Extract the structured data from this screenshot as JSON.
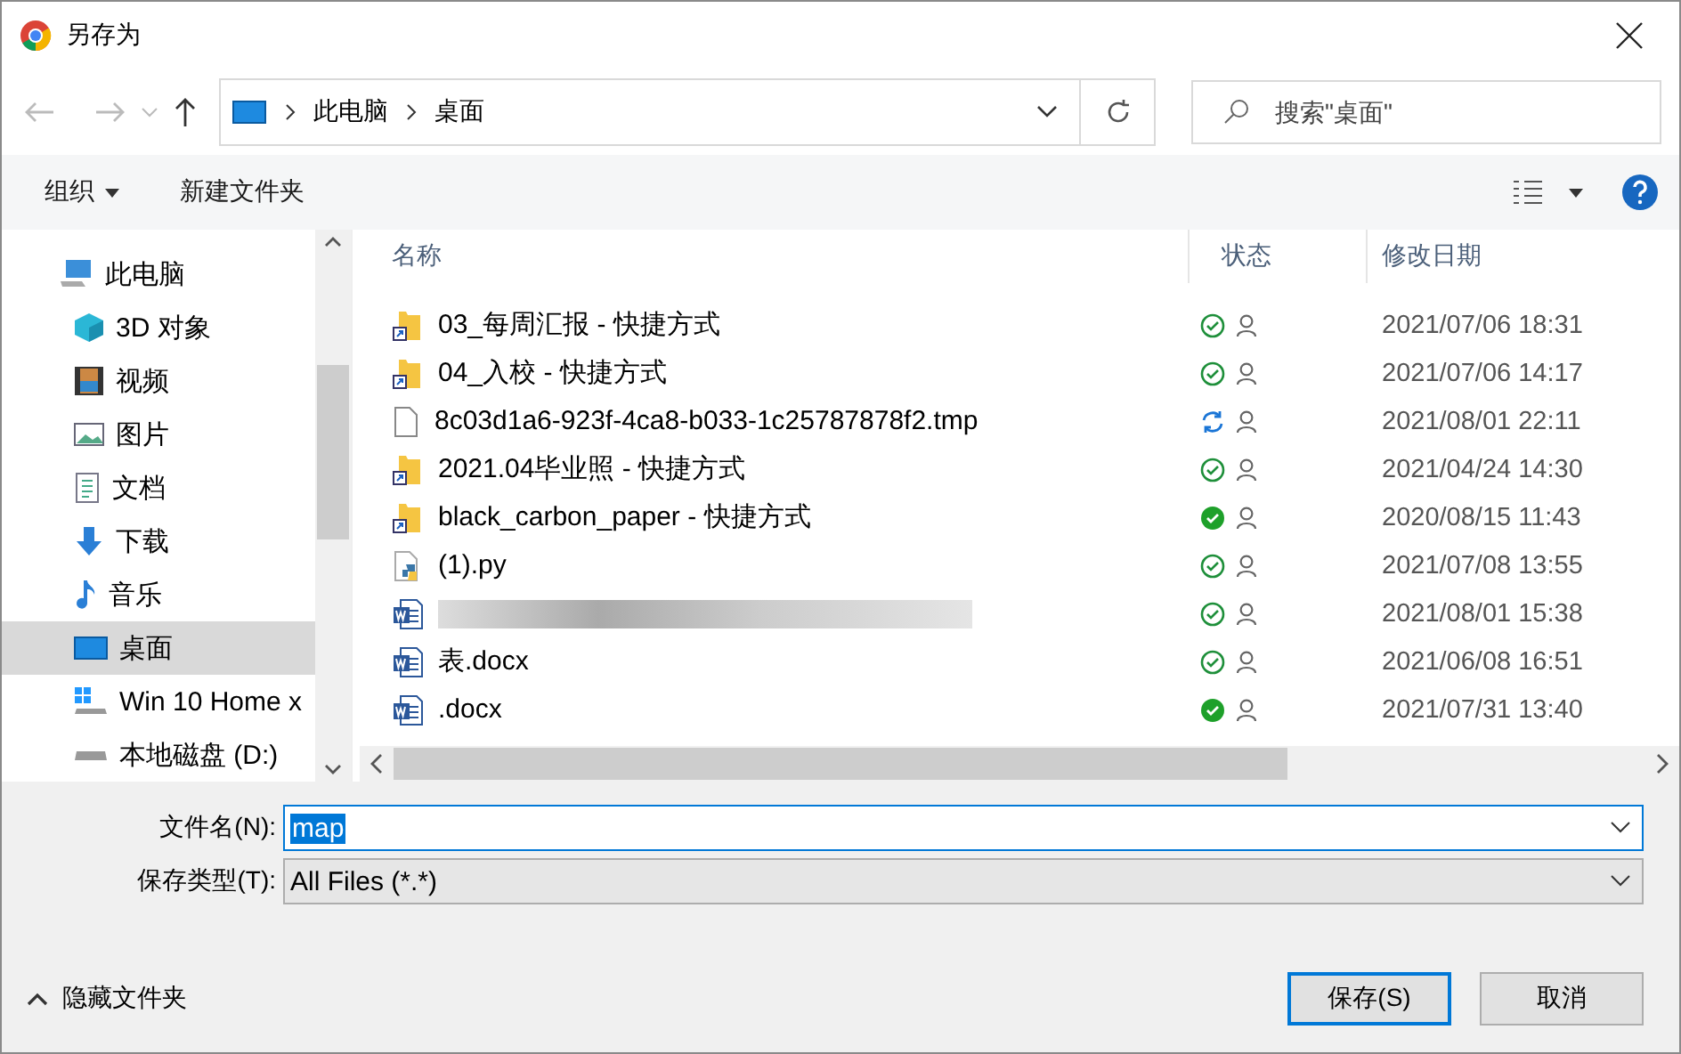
{
  "window": {
    "title": "另存为"
  },
  "address": {
    "path": [
      "此电脑",
      "桌面"
    ],
    "search_placeholder": "搜索\"桌面\""
  },
  "toolbar": {
    "organize": "组织",
    "new_folder": "新建文件夹"
  },
  "sidebar": {
    "items": [
      {
        "label": "此电脑",
        "selected": false,
        "children": [
          {
            "label": "3D 对象",
            "selected": false
          },
          {
            "label": "视频",
            "selected": false
          },
          {
            "label": "图片",
            "selected": false
          },
          {
            "label": "文档",
            "selected": false
          },
          {
            "label": "下载",
            "selected": false
          },
          {
            "label": "音乐",
            "selected": false
          },
          {
            "label": "桌面",
            "selected": true
          },
          {
            "label": "Win 10 Home x",
            "selected": false
          },
          {
            "label": "本地磁盘 (D:)",
            "selected": false
          }
        ]
      }
    ]
  },
  "table": {
    "columns": [
      "名称",
      "状态",
      "修改日期"
    ],
    "rows": [
      {
        "name": "03_每周汇报 - 快捷方式",
        "kind": "shortcut",
        "status": {
          "kind": "synced"
        },
        "date": "2021/07/06 18:31"
      },
      {
        "name": "04_入校 - 快捷方式",
        "kind": "shortcut",
        "status": {
          "kind": "synced"
        },
        "date": "2021/07/06 14:17"
      },
      {
        "name": "8c03d1a6-923f-4ca8-b033-1c25787878f2.tmp",
        "kind": "file",
        "status": {
          "kind": "syncing"
        },
        "date": "2021/08/01 22:11"
      },
      {
        "name": "2021.04毕业照 - 快捷方式",
        "kind": "shortcut",
        "status": {
          "kind": "synced"
        },
        "date": "2021/04/24 14:30"
      },
      {
        "name": "black_carbon_paper - 快捷方式",
        "kind": "shortcut",
        "status": {
          "kind": "local"
        },
        "date": "2020/08/15 11:43"
      },
      {
        "name": "(1).py",
        "kind": "python",
        "status": {
          "kind": "synced"
        },
        "date": "2021/07/08 13:55"
      },
      {
        "kind": "word",
        "status": {
          "kind": "synced"
        },
        "date": "2021/08/01 15:38"
      },
      {
        "name": "表.docx",
        "kind": "word",
        "status": {
          "kind": "synced"
        },
        "date": "2021/06/08 16:51"
      },
      {
        "name": ".docx",
        "kind": "word",
        "status": {
          "kind": "local"
        },
        "date": "2021/07/31 13:40"
      }
    ]
  },
  "form": {
    "filename_label": "文件名(N):",
    "filename": "map",
    "type_label": "保存类型(T):",
    "type": "All Files (*.*)"
  },
  "footer": {
    "hide_folders": "隐藏文件夹",
    "buttons": [
      "保存(S)",
      "取消"
    ]
  }
}
